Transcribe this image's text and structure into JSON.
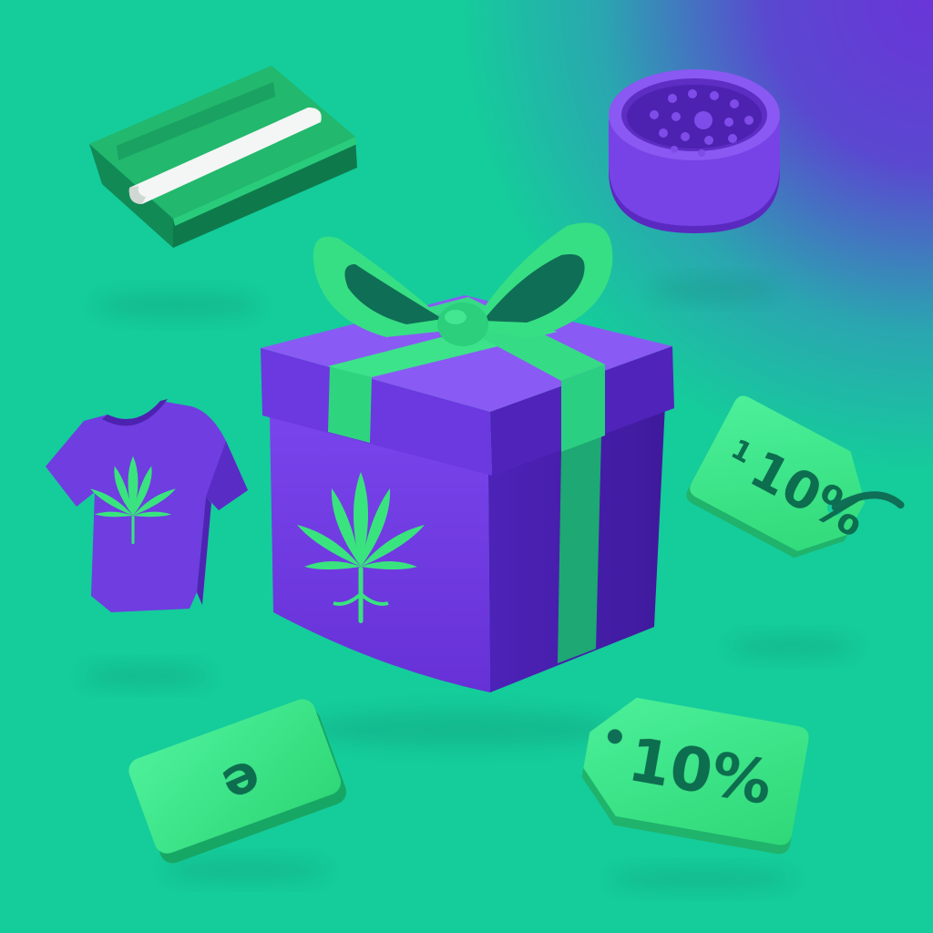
{
  "colors": {
    "background_green": "#15cc9b",
    "background_purple": "#6a35d8",
    "box_purple": "#7c47ee",
    "box_dark_purple": "#4b1fae",
    "ribbon_green": "#33e27f",
    "ribbon_dark_green": "#0f7a5c",
    "tag_green": "#3ce883",
    "tag_text_green": "#0d6d4f"
  },
  "illustration": {
    "gift_box": {
      "icon": "cannabis-leaf-icon"
    },
    "tshirt": {
      "icon": "cannabis-leaf-icon"
    },
    "rolling_papers": {
      "icon": "rolling-papers-icon"
    },
    "grinder": {
      "icon": "herb-grinder-icon"
    },
    "tag_right": {
      "text": "10%",
      "prefix_glyph": "1"
    },
    "tag_bottom": {
      "text": "10%"
    },
    "card": {
      "glyph": "ə"
    }
  }
}
